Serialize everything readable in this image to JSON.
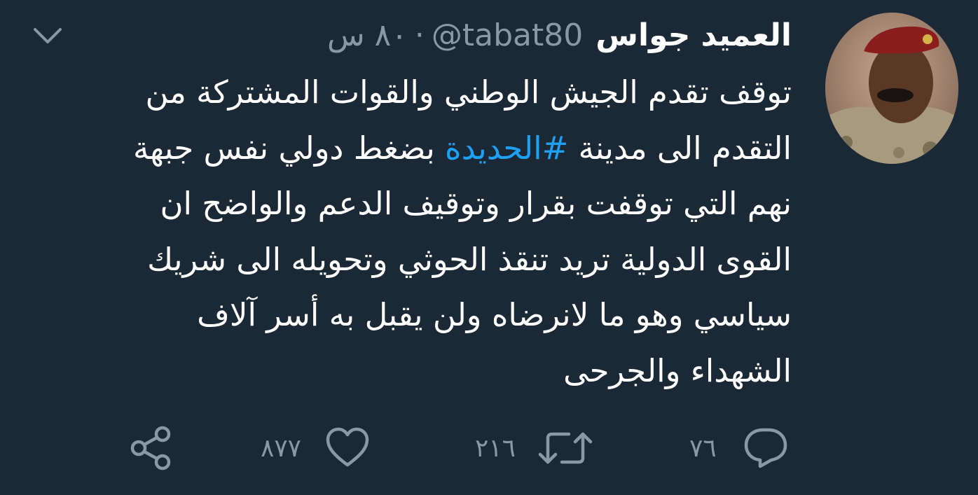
{
  "tweet": {
    "display_name": "العميد جواس",
    "handle": "@tabat80",
    "separator": "·",
    "time": "٨٠ س",
    "text_lines": [
      [
        "توقف تقدم الجيش الوطني والقوات المشتركة من"
      ],
      [
        "التقدم الى مدينة ",
        "#الحديدة",
        " بضغط دولي نفس جبهة"
      ],
      [
        "نهم التي توقفت بقرار وتوقيف الدعم والواضح ان"
      ],
      [
        "القوى الدولية تريد تنقذ الحوثي وتحويله الى شريك"
      ],
      [
        "سياسي وهو ما لانرضاه ولن يقبل به أسر آلاف"
      ],
      [
        "الشهداء والجرحى"
      ]
    ],
    "hashtag": "#الحديدة",
    "line1": "توقف تقدم الجيش الوطني والقوات المشتركة من",
    "line2_before": "التقدم الى مدينة ",
    "line2_after": " بضغط دولي نفس جبهة",
    "line3": "نهم التي توقفت بقرار وتوقيف الدعم والواضح ان",
    "line4": "القوى الدولية تريد تنقذ الحوثي وتحويله الى شريك",
    "line5": "سياسي وهو ما لانرضاه ولن يقبل به أسر آلاف",
    "line6": "الشهداء والجرحى"
  },
  "actions": {
    "reply_count": "٧٦",
    "retweet_count": "٢١٦",
    "like_count": "٨٧٧"
  },
  "icons": {
    "avatar": "avatar",
    "caret": "chevron-down-icon",
    "reply": "reply-icon",
    "retweet": "retweet-icon",
    "like": "heart-icon",
    "share": "share-icon"
  },
  "colors": {
    "background": "#1b2836",
    "text": "#ffffff",
    "muted": "#8899a6",
    "link": "#1da1f2"
  }
}
